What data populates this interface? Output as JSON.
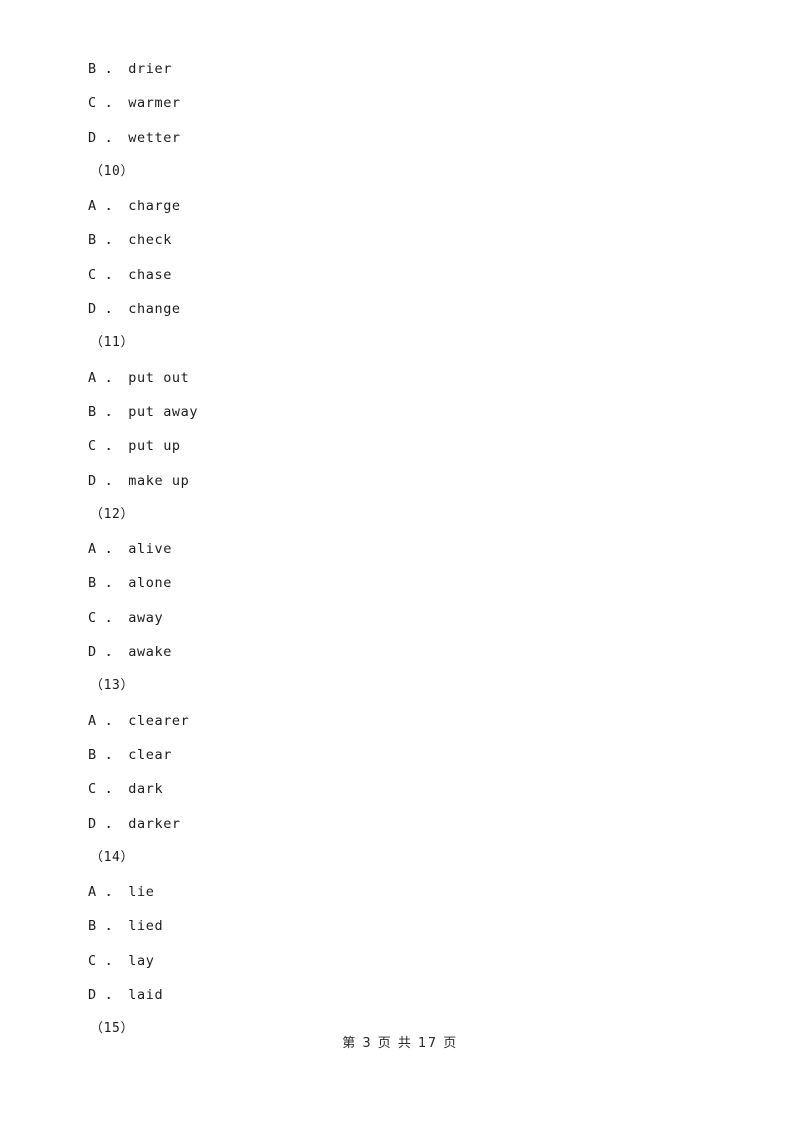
{
  "document": {
    "page_background": "#ffffff",
    "text_color": "#1c1c1c",
    "lines": [
      {
        "kind": "option",
        "text": "B ． drier"
      },
      {
        "kind": "option",
        "text": "C ． warmer"
      },
      {
        "kind": "option",
        "text": "D ． wetter"
      },
      {
        "kind": "qnum",
        "text": "（10）"
      },
      {
        "kind": "option",
        "text": "A ． charge"
      },
      {
        "kind": "option",
        "text": "B ． check"
      },
      {
        "kind": "option",
        "text": "C ． chase"
      },
      {
        "kind": "option",
        "text": "D ． change"
      },
      {
        "kind": "qnum",
        "text": "（11）"
      },
      {
        "kind": "option",
        "text": "A ． put out"
      },
      {
        "kind": "option",
        "text": "B ． put away"
      },
      {
        "kind": "option",
        "text": "C ． put up"
      },
      {
        "kind": "option",
        "text": "D ． make up"
      },
      {
        "kind": "qnum",
        "text": "（12）"
      },
      {
        "kind": "option",
        "text": "A ． alive"
      },
      {
        "kind": "option",
        "text": "B ． alone"
      },
      {
        "kind": "option",
        "text": "C ． away"
      },
      {
        "kind": "option",
        "text": "D ． awake"
      },
      {
        "kind": "qnum",
        "text": "（13）"
      },
      {
        "kind": "option",
        "text": "A ． clearer"
      },
      {
        "kind": "option",
        "text": "B ． clear"
      },
      {
        "kind": "option",
        "text": "C ． dark"
      },
      {
        "kind": "option",
        "text": "D ． darker"
      },
      {
        "kind": "qnum",
        "text": "（14）"
      },
      {
        "kind": "option",
        "text": "A ． lie"
      },
      {
        "kind": "option",
        "text": "B ． lied"
      },
      {
        "kind": "option",
        "text": "C ． lay"
      },
      {
        "kind": "option",
        "text": "D ． laid"
      },
      {
        "kind": "qnum",
        "text": "（15）"
      }
    ]
  },
  "footer": {
    "page_label": "第 3 页 共 17 页",
    "current_page": 3,
    "total_pages": 17
  }
}
